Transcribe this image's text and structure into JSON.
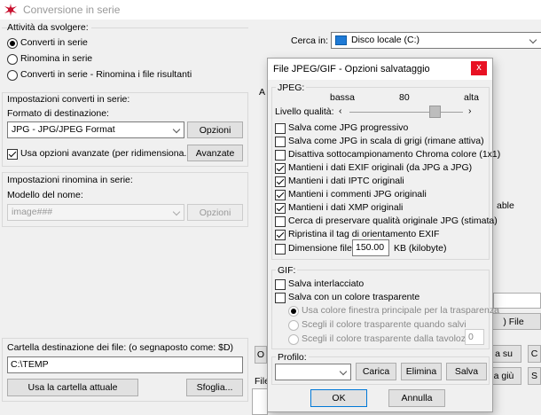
{
  "window": {
    "title": "Conversione in serie"
  },
  "left": {
    "activity": {
      "title": "Attività da svolgere:",
      "options": [
        {
          "label": "Converti in serie",
          "checked": true
        },
        {
          "label": "Rinomina in serie",
          "checked": false
        },
        {
          "label": "Converti in serie - Rinomina i file risultanti",
          "checked": false
        }
      ]
    },
    "convert_settings": {
      "title": "Impostazioni converti in serie:",
      "format_label": "Formato di destinazione:",
      "format_value": "JPG - JPG/JPEG Format",
      "options_button": "Opzioni",
      "advanced_checkbox": "Usa opzioni avanzate (per ridimensiona...)",
      "advanced_checked": true,
      "advanced_button": "Avanzate"
    },
    "rename_settings": {
      "title": "Impostazioni rinomina in serie:",
      "model_label": "Modello del nome:",
      "model_value": "image###",
      "options_button": "Opzioni"
    },
    "destination": {
      "label": "Cartella destinazione dei file: (o segnaposto come: $D)",
      "value": "C:\\TEMP",
      "use_current_button": "Usa la cartella attuale",
      "browse_button": "Sfoglia..."
    }
  },
  "right": {
    "search_label": "Cerca in:",
    "search_value": "Disco locale (C:)",
    "partial_a": "A",
    "partial_able": "able",
    "partial_o": "O",
    "partial_file": "File",
    "file_button": ") File",
    "up_button": "a su",
    "down_button": "a giù",
    "c_button": "C",
    "s_button": "S"
  },
  "dialog": {
    "title": "File JPEG/GIF - Opzioni salvataggio",
    "close": "x",
    "jpeg": {
      "group": "JPEG:",
      "low": "bassa",
      "value": "80",
      "high": "alta",
      "quality_label": "Livello qualità:",
      "quality_fraction": 0.8,
      "options": [
        {
          "label": "Salva come JPG progressivo",
          "checked": false
        },
        {
          "label": "Salva come JPG in scala di grigi (rimane attiva)",
          "checked": false
        },
        {
          "label": "Disattiva sottocampionamento Chroma colore (1x1)",
          "checked": false
        },
        {
          "label": "Mantieni i dati EXIF originali (da JPG a JPG)",
          "checked": true
        },
        {
          "label": "Mantieni i dati IPTC originali",
          "checked": true
        },
        {
          "label": "Mantieni i commenti JPG originali",
          "checked": true
        },
        {
          "label": "Mantieni i dati XMP originali",
          "checked": true
        },
        {
          "label": "Cerca di preservare qualità originale JPG (stimata)",
          "checked": false
        },
        {
          "label": "Ripristina il tag di orientamento EXIF",
          "checked": true
        }
      ],
      "filesize_label": "Dimensione file:",
      "filesize_checked": false,
      "filesize_value": "150.00",
      "filesize_unit": "KB (kilobyte)"
    },
    "gif": {
      "group": "GIF:",
      "interlace": "Salva interlacciato",
      "transparent": "Salva con un colore trasparente",
      "radio1": "Usa colore finestra principale per la trasparenza",
      "radio2": "Scegli il colore trasparente quando salvi",
      "radio3": "Scegli il colore trasparente dalla tavolozza:",
      "palette_value": "0"
    },
    "profile": {
      "group": "Profilo:",
      "load": "Carica",
      "delete": "Elimina",
      "save": "Salva"
    },
    "ok": "OK",
    "cancel": "Annulla"
  }
}
